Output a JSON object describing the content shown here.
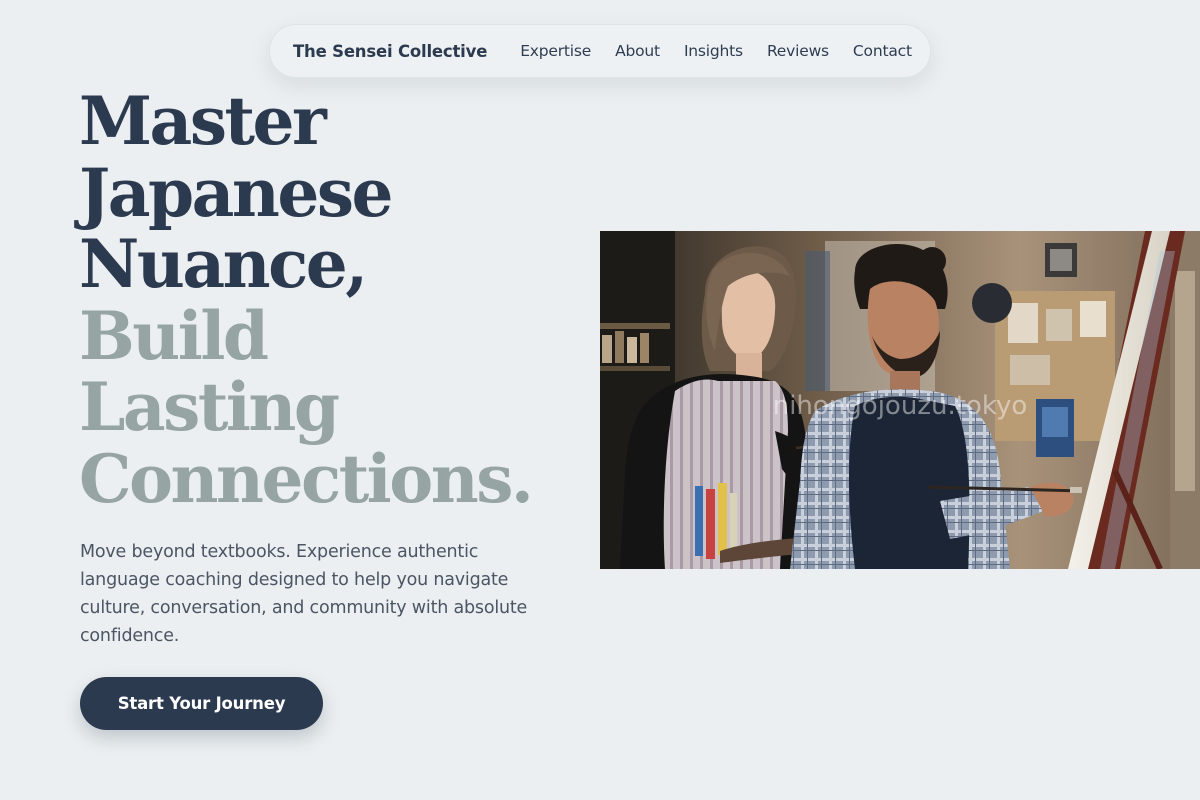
{
  "nav": {
    "brand": "The Sensei Collective",
    "links": [
      "Expertise",
      "About",
      "Insights",
      "Reviews",
      "Contact"
    ]
  },
  "hero": {
    "headline_dark": [
      "Master",
      "Japanese",
      "Nuance,"
    ],
    "headline_muted": [
      "Build",
      "Lasting",
      "Connections."
    ],
    "description": "Move beyond textbooks. Experience authentic language coaching designed to help you navigate culture, conversation, and community with absolute confidence.",
    "cta_label": "Start Your Journey",
    "image": {
      "subject": "two people painting at an easel in an art studio",
      "watermark": "nihongojouzu.tokyo"
    }
  },
  "colors": {
    "background": "#ebeff1",
    "primary": "#2b3a4f",
    "muted_headline": "#96a4a4",
    "body_text": "#4b5563"
  }
}
